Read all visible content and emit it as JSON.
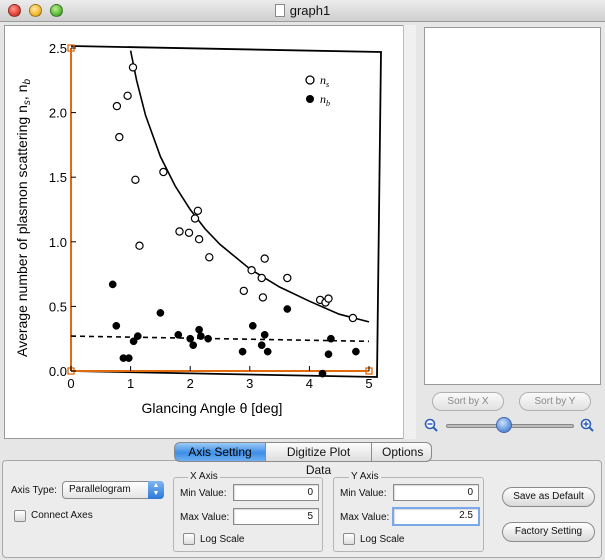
{
  "window": {
    "title": "graph1"
  },
  "plot": {
    "ylabel": "Average number of plasmon scattering n",
    "ylabel_sub": "s",
    "ylabel_sep": ", n",
    "ylabel_sub2": "b",
    "xlabel": "Glancing Angle θ [deg]",
    "x_ticks": [
      "0",
      "1",
      "2",
      "3",
      "4",
      "5"
    ],
    "y_ticks": [
      "0.0",
      "0.5",
      "1.0",
      "1.5",
      "2.0",
      "2.5"
    ],
    "legend": [
      {
        "symbol": "open-circle",
        "label": "n",
        "sub": "s"
      },
      {
        "symbol": "filled-circle",
        "label": "n",
        "sub": "b"
      }
    ]
  },
  "chart_data": {
    "type": "scatter",
    "xlabel": "Glancing Angle θ [deg]",
    "ylabel": "Average number of plasmon scattering ns, nb",
    "xlim": [
      0,
      5
    ],
    "ylim": [
      0,
      2.5
    ],
    "series": [
      {
        "name": "ns",
        "marker": "open-circle",
        "points": [
          [
            0.77,
            2.05
          ],
          [
            0.81,
            1.81
          ],
          [
            0.95,
            2.13
          ],
          [
            1.04,
            2.35
          ],
          [
            1.08,
            1.48
          ],
          [
            1.15,
            0.97
          ],
          [
            1.55,
            1.54
          ],
          [
            1.82,
            1.08
          ],
          [
            1.98,
            1.07
          ],
          [
            2.08,
            1.18
          ],
          [
            2.13,
            1.24
          ],
          [
            2.15,
            1.02
          ],
          [
            2.32,
            0.88
          ],
          [
            2.9,
            0.62
          ],
          [
            3.03,
            0.78
          ],
          [
            3.2,
            0.72
          ],
          [
            3.22,
            0.57
          ],
          [
            3.25,
            0.87
          ],
          [
            3.63,
            0.72
          ],
          [
            4.18,
            0.55
          ],
          [
            4.27,
            0.53
          ],
          [
            4.32,
            0.56
          ],
          [
            4.73,
            0.41
          ]
        ]
      },
      {
        "name": "nb",
        "marker": "filled-circle",
        "points": [
          [
            0.7,
            0.67
          ],
          [
            0.76,
            0.35
          ],
          [
            0.88,
            0.1
          ],
          [
            0.97,
            0.1
          ],
          [
            1.05,
            0.23
          ],
          [
            1.12,
            0.27
          ],
          [
            1.5,
            0.45
          ],
          [
            1.8,
            0.28
          ],
          [
            2.0,
            0.25
          ],
          [
            2.05,
            0.2
          ],
          [
            2.15,
            0.32
          ],
          [
            2.18,
            0.27
          ],
          [
            2.3,
            0.25
          ],
          [
            2.88,
            0.15
          ],
          [
            3.05,
            0.35
          ],
          [
            3.2,
            0.2
          ],
          [
            3.25,
            0.28
          ],
          [
            3.3,
            0.15
          ],
          [
            3.63,
            0.48
          ],
          [
            4.22,
            -0.02
          ],
          [
            4.32,
            0.13
          ],
          [
            4.36,
            0.25
          ],
          [
            4.78,
            0.15
          ]
        ]
      }
    ],
    "fits": [
      {
        "for": "ns",
        "style": "solid",
        "points": [
          [
            1.0,
            2.48
          ],
          [
            1.1,
            2.25
          ],
          [
            1.25,
            1.98
          ],
          [
            1.5,
            1.66
          ],
          [
            1.75,
            1.43
          ],
          [
            2.0,
            1.25
          ],
          [
            2.25,
            1.1
          ],
          [
            2.5,
            0.98
          ],
          [
            3.0,
            0.79
          ],
          [
            3.5,
            0.65
          ],
          [
            4.0,
            0.54
          ],
          [
            4.5,
            0.44
          ],
          [
            5.0,
            0.38
          ]
        ]
      },
      {
        "for": "nb",
        "style": "dashed",
        "points": [
          [
            0.0,
            0.27
          ],
          [
            5.0,
            0.23
          ]
        ]
      }
    ]
  },
  "list_panel": {
    "sort_x_label": "Sort by X",
    "sort_y_label": "Sort by Y",
    "zoom_level": 0.45
  },
  "tabs": [
    {
      "label": "Axis Setting",
      "active": true
    },
    {
      "label": "Digitize Plot Data",
      "active": false
    },
    {
      "label": "Options",
      "active": false
    }
  ],
  "axis_settings": {
    "axis_type_label": "Axis Type:",
    "axis_type_value": "Parallelogram",
    "connect_axes_label": "Connect Axes",
    "connect_axes_checked": false,
    "x_axis": {
      "title": "X Axis",
      "min_label": "Min Value:",
      "min_value": "0",
      "max_label": "Max Value:",
      "max_value": "5",
      "log_label": "Log Scale",
      "log_checked": false
    },
    "y_axis": {
      "title": "Y Axis",
      "min_label": "Min Value:",
      "min_value": "0",
      "max_label": "Max Value:",
      "max_value": "2.5",
      "log_label": "Log Scale",
      "log_checked": false
    },
    "save_default_label": "Save as Default",
    "factory_setting_label": "Factory Setting"
  }
}
